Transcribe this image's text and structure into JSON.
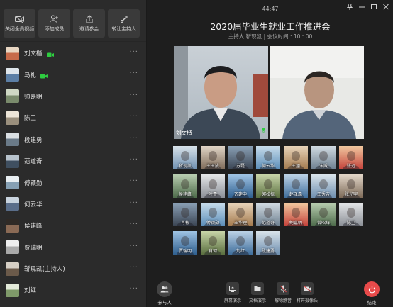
{
  "toolbar": [
    {
      "label": "关闭全员视频",
      "icon": "video-off-icon"
    },
    {
      "label": "添加成员",
      "icon": "add-user-icon"
    },
    {
      "label": "邀请参会",
      "icon": "share-icon"
    },
    {
      "label": "转让主持人",
      "icon": "transfer-host-icon"
    }
  ],
  "participants": [
    {
      "name": "刘文楷",
      "camera": true
    },
    {
      "name": "马礼",
      "camera": true
    },
    {
      "name": "帅嘉明",
      "camera": false
    },
    {
      "name": "陈卫",
      "camera": false
    },
    {
      "name": "段建勇",
      "camera": false
    },
    {
      "name": "范道奇",
      "camera": false
    },
    {
      "name": "傅颖勋",
      "camera": false
    },
    {
      "name": "何云华",
      "camera": false
    },
    {
      "name": "侯建峰",
      "camera": false
    },
    {
      "name": "贾瑞明",
      "camera": false
    },
    {
      "name": "靳现凯(主持人)",
      "camera": false
    },
    {
      "name": "刘红",
      "camera": false
    }
  ],
  "more_glyph": "···",
  "meeting": {
    "timer": "44:47",
    "title": "2020届毕业生就业工作推进会",
    "subtitle": "主持人:靳现凯 | 会议时间 : 10 : 00"
  },
  "videos": [
    {
      "name": "刘文楷"
    },
    {
      "name": ""
    }
  ],
  "tiles": [
    [
      "靳现凯",
      "王玉成",
      "苏磊",
      "何云华",
      "王旭",
      "宋威",
      "张远"
    ],
    [
      "侯建峰",
      "叶青",
      "齐建中",
      "郭松振",
      "赵泽森",
      "王秀吉",
      "张光宇"
    ],
    [
      "肖彬",
      "傅颖勋",
      "王华理",
      "范道奇",
      "鲍嘉明",
      "曾昭辉",
      "陈卫"
    ],
    [
      "贾瑞明",
      "肖珂",
      "刘红",
      "段建勇"
    ]
  ],
  "controls": {
    "participants_label": "参与人",
    "screen_share_label": "屏幕演示",
    "doc_share_label": "文档演示",
    "unmute_label": "解除静音",
    "camera_label": "打开摄像头",
    "end_label": "结束"
  },
  "colors": {
    "camera_active": "#2ecc40",
    "end_button": "#e84a4a"
  }
}
